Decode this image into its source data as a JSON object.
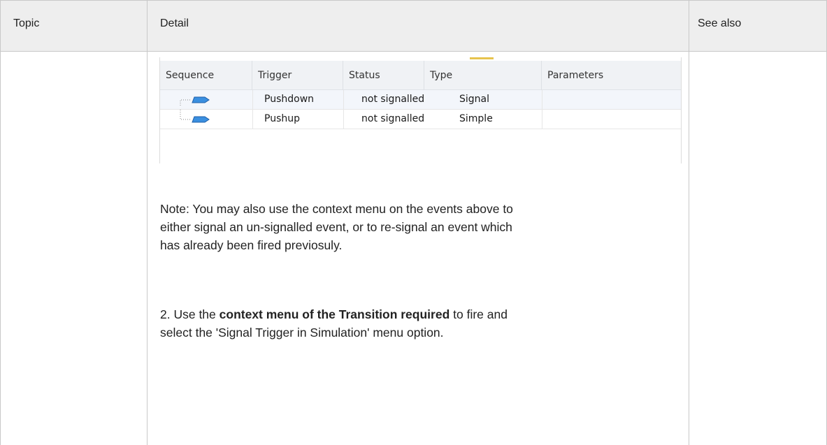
{
  "table": {
    "headers": {
      "topic": "Topic",
      "detail": "Detail",
      "see_also": "See also"
    }
  },
  "simulation_events": {
    "columns": [
      "Sequence",
      "Trigger",
      "Status",
      "Type",
      "Parameters"
    ],
    "rows": [
      {
        "sequence_icon": "event-arrow-icon",
        "trigger": "Pushdown",
        "status": "not signalled",
        "type": "Signal",
        "parameters": ""
      },
      {
        "sequence_icon": "event-arrow-icon",
        "trigger": "Pushup",
        "status": "not signalled",
        "type": "Simple",
        "parameters": ""
      }
    ],
    "icon_color": "#3a8fe0"
  },
  "detail": {
    "note_line1": "Note: You may also use the context menu on the events above to",
    "note_line2": "either signal an un-signalled event, or to re-signal an event which",
    "note_line3": "has already been fired previosuly.",
    "step2_prefix": "2. Use the ",
    "step2_bold": "context menu of the Transition required",
    "step2_suffix": " to fire and",
    "step2_line2": "select the 'Signal Trigger in Simulation' menu option."
  }
}
